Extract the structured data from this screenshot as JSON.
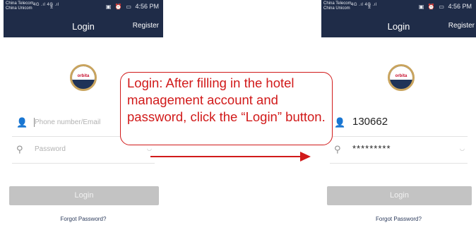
{
  "status_bar": {
    "carrier_1": "China Telecom",
    "carrier_2": "China Unicom",
    "signal_text": "4G .ıl 4G .ıl",
    "time": "4:56 PM"
  },
  "left_screen": {
    "title": "Login",
    "register_label": "Register",
    "logo_text": "orbita",
    "phone_placeholder": "Phone number/Email",
    "password_placeholder": "Password",
    "login_label": "Login",
    "forgot_label": "Forgot Password?"
  },
  "right_screen": {
    "title": "Login",
    "register_label": "Register",
    "logo_text": "orbita",
    "phone_value": "130662",
    "password_value": "*********",
    "login_label": "Login",
    "forgot_label": "Forgot Password?"
  },
  "callout": {
    "text": "Login: After filling in the hotel management account and password, click the  “Login” button."
  },
  "colors": {
    "header_bg": "#1f2c48",
    "login_button_disabled": "#c3c3c3",
    "annotation_red": "#d11a1a",
    "logo_navy": "#1f3358",
    "logo_gold": "#c9a45e"
  },
  "icons": {
    "user_field": "user-icon",
    "password_field": "key-icon",
    "password_toggle": "eye-icon",
    "download": "download-icon",
    "vibrate": "vibrate-icon",
    "alarm": "alarm-icon",
    "battery": "battery-icon",
    "annotation_arrow": "arrow-right-icon"
  }
}
